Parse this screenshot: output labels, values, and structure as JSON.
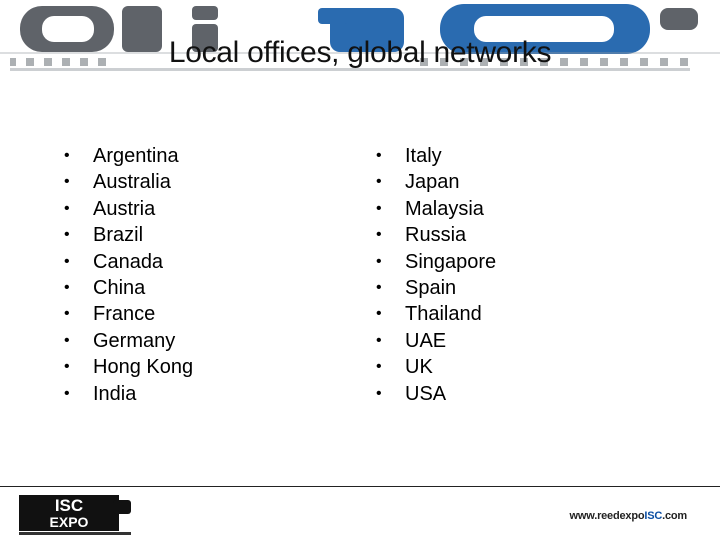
{
  "slide": {
    "title": "Local offices, global networks"
  },
  "banner": {
    "logo_text": "01 10",
    "icon": "event-logo-banner"
  },
  "list_left": [
    "Argentina",
    "Australia",
    "Austria",
    "Brazil",
    "Canada",
    "China",
    "France",
    "Germany",
    "Hong Kong",
    "India"
  ],
  "list_right": [
    "Italy",
    "Japan",
    "Malaysia",
    "Russia",
    "Singapore",
    "Spain",
    "Thailand",
    "UAE",
    "UK",
    "USA"
  ],
  "bullet_char": "•",
  "footer": {
    "logo_text": "ISC EXPO",
    "url_prefix": "www.reedexpo",
    "url_accent": "ISC",
    "url_suffix": ".com"
  },
  "colors": {
    "banner_gray": "#5f6369",
    "banner_blue": "#2a6bb0",
    "accent": "#0a4ea3"
  }
}
